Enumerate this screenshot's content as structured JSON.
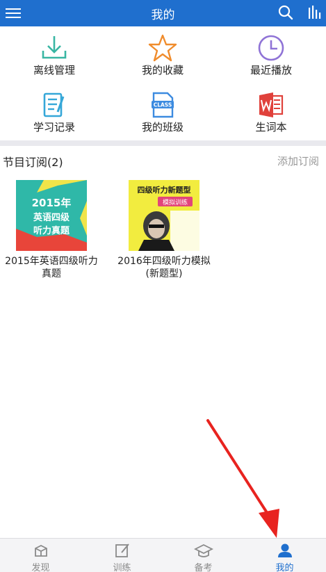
{
  "header": {
    "title": "我的",
    "menu_icon": "hamburger-menu-icon",
    "search_icon": "search-icon",
    "stats_icon": "bar-chart-icon",
    "bg_color": "#1f6fce"
  },
  "shortcuts": [
    {
      "label": "离线管理",
      "icon": "download-icon",
      "color": "#39b6a3"
    },
    {
      "label": "我的收藏",
      "icon": "star-icon",
      "color": "#f08c2c"
    },
    {
      "label": "最近播放",
      "icon": "clock-icon",
      "color": "#8f73d6"
    },
    {
      "label": "学习记录",
      "icon": "notebook-icon",
      "color": "#35a7d8"
    },
    {
      "label": "我的班级",
      "icon": "class-icon",
      "color": "#3c8be0"
    },
    {
      "label": "生词本",
      "icon": "word-document-icon",
      "color": "#e0413b"
    }
  ],
  "subscriptions": {
    "header": "节目订阅(2)",
    "add_label": "添加订阅",
    "items": [
      {
        "title": "2015年英语四级听力真题",
        "cover_line1": "2015年",
        "cover_line2": "英语四级",
        "cover_line3": "听力真题"
      },
      {
        "title": "2016年四级听力模拟(新题型)",
        "cover_line1": "四级听力新题型",
        "cover_line2": "模拟训练"
      }
    ]
  },
  "tabbar": {
    "tabs": [
      {
        "label": "发现",
        "icon": "discover-box-icon",
        "active": false
      },
      {
        "label": "训练",
        "icon": "edit-icon",
        "active": false
      },
      {
        "label": "备考",
        "icon": "graduation-cap-icon",
        "active": false
      },
      {
        "label": "我的",
        "icon": "user-icon",
        "active": true
      }
    ],
    "active_color": "#1f6fce"
  },
  "annotation": {
    "arrow_color": "#e8231f",
    "target": "我的"
  }
}
